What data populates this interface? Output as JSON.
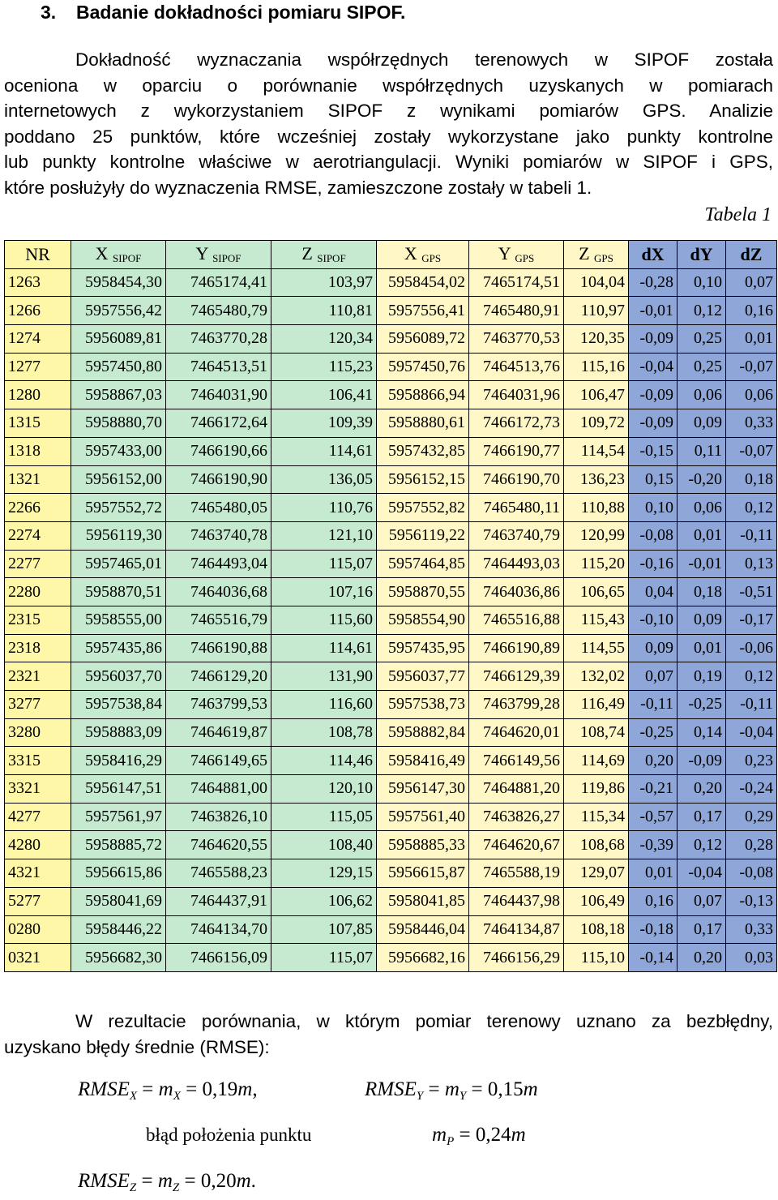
{
  "section": {
    "number": "3.",
    "title": "Badanie dokładności pomiaru SIPOF."
  },
  "intro_lines": [
    "Dokładność wyznaczania współrzędnych terenowych w SIPOF została",
    "oceniona w oparciu o porównanie współrzędnych uzyskanych w pomiarach",
    "internetowych z wykorzystaniem SIPOF z wynikami pomiarów GPS. Analizie",
    "poddano 25 punktów, które wcześniej zostały wykorzystane jako punkty kontrolne",
    "lub punkty kontrolne właściwe w aerotriangulacji. Wyniki pomiarów w SIPOF i GPS,",
    "które posłużyły do wyznaczenia RMSE, zamieszczone zostały w tabeli 1."
  ],
  "caption": "Tabela 1",
  "table": {
    "headers": [
      {
        "main": "NR",
        "sub": ""
      },
      {
        "main": "X",
        "sub": "SIPOF"
      },
      {
        "main": "Y",
        "sub": "SIPOF"
      },
      {
        "main": "Z",
        "sub": "SIPOF"
      },
      {
        "main": "X",
        "sub": "GPS"
      },
      {
        "main": "Y",
        "sub": "GPS"
      },
      {
        "main": "Z",
        "sub": "GPS"
      },
      {
        "main": "dX",
        "sub": ""
      },
      {
        "main": "dY",
        "sub": ""
      },
      {
        "main": "dZ",
        "sub": ""
      }
    ],
    "rows": [
      [
        "1263",
        "5958454,30",
        "7465174,41",
        "103,97",
        "5958454,02",
        "7465174,51",
        "104,04",
        "-0,28",
        "0,10",
        "0,07"
      ],
      [
        "1266",
        "5957556,42",
        "7465480,79",
        "110,81",
        "5957556,41",
        "7465480,91",
        "110,97",
        "-0,01",
        "0,12",
        "0,16"
      ],
      [
        "1274",
        "5956089,81",
        "7463770,28",
        "120,34",
        "5956089,72",
        "7463770,53",
        "120,35",
        "-0,09",
        "0,25",
        "0,01"
      ],
      [
        "1277",
        "5957450,80",
        "7464513,51",
        "115,23",
        "5957450,76",
        "7464513,76",
        "115,16",
        "-0,04",
        "0,25",
        "-0,07"
      ],
      [
        "1280",
        "5958867,03",
        "7464031,90",
        "106,41",
        "5958866,94",
        "7464031,96",
        "106,47",
        "-0,09",
        "0,06",
        "0,06"
      ],
      [
        "1315",
        "5958880,70",
        "7466172,64",
        "109,39",
        "5958880,61",
        "7466172,73",
        "109,72",
        "-0,09",
        "0,09",
        "0,33"
      ],
      [
        "1318",
        "5957433,00",
        "7466190,66",
        "114,61",
        "5957432,85",
        "7466190,77",
        "114,54",
        "-0,15",
        "0,11",
        "-0,07"
      ],
      [
        "1321",
        "5956152,00",
        "7466190,90",
        "136,05",
        "5956152,15",
        "7466190,70",
        "136,23",
        "0,15",
        "-0,20",
        "0,18"
      ],
      [
        "2266",
        "5957552,72",
        "7465480,05",
        "110,76",
        "5957552,82",
        "7465480,11",
        "110,88",
        "0,10",
        "0,06",
        "0,12"
      ],
      [
        "2274",
        "5956119,30",
        "7463740,78",
        "121,10",
        "5956119,22",
        "7463740,79",
        "120,99",
        "-0,08",
        "0,01",
        "-0,11"
      ],
      [
        "2277",
        "5957465,01",
        "7464493,04",
        "115,07",
        "5957464,85",
        "7464493,03",
        "115,20",
        "-0,16",
        "-0,01",
        "0,13"
      ],
      [
        "2280",
        "5958870,51",
        "7464036,68",
        "107,16",
        "5958870,55",
        "7464036,86",
        "106,65",
        "0,04",
        "0,18",
        "-0,51"
      ],
      [
        "2315",
        "5958555,00",
        "7465516,79",
        "115,60",
        "5958554,90",
        "7465516,88",
        "115,43",
        "-0,10",
        "0,09",
        "-0,17"
      ],
      [
        "2318",
        "5957435,86",
        "7466190,88",
        "114,61",
        "5957435,95",
        "7466190,89",
        "114,55",
        "0,09",
        "0,01",
        "-0,06"
      ],
      [
        "2321",
        "5956037,70",
        "7466129,20",
        "131,90",
        "5956037,77",
        "7466129,39",
        "132,02",
        "0,07",
        "0,19",
        "0,12"
      ],
      [
        "3277",
        "5957538,84",
        "7463799,53",
        "116,60",
        "5957538,73",
        "7463799,28",
        "116,49",
        "-0,11",
        "-0,25",
        "-0,11"
      ],
      [
        "3280",
        "5958883,09",
        "7464619,87",
        "108,78",
        "5958882,84",
        "7464620,01",
        "108,74",
        "-0,25",
        "0,14",
        "-0,04"
      ],
      [
        "3315",
        "5958416,29",
        "7466149,65",
        "114,46",
        "5958416,49",
        "7466149,56",
        "114,69",
        "0,20",
        "-0,09",
        "0,23"
      ],
      [
        "3321",
        "5956147,51",
        "7464881,00",
        "120,10",
        "5956147,30",
        "7464881,20",
        "119,86",
        "-0,21",
        "0,20",
        "-0,24"
      ],
      [
        "4277",
        "5957561,97",
        "7463826,10",
        "115,05",
        "5957561,40",
        "7463826,27",
        "115,34",
        "-0,57",
        "0,17",
        "0,29"
      ],
      [
        "4280",
        "5958885,72",
        "7464620,55",
        "108,40",
        "5958885,33",
        "7464620,67",
        "108,68",
        "-0,39",
        "0,12",
        "0,28"
      ],
      [
        "4321",
        "5956615,86",
        "7465588,23",
        "129,15",
        "5956615,87",
        "7465588,19",
        "129,07",
        "0,01",
        "-0,04",
        "-0,08"
      ],
      [
        "5277",
        "5958041,69",
        "7464437,91",
        "106,62",
        "5958041,85",
        "7464437,98",
        "106,49",
        "0,16",
        "0,07",
        "-0,13"
      ],
      [
        "0280",
        "5958446,22",
        "7464134,70",
        "107,85",
        "5958446,04",
        "7464134,87",
        "108,18",
        "-0,18",
        "0,17",
        "0,33"
      ],
      [
        "0321",
        "5956682,30",
        "7466156,09",
        "115,07",
        "5956682,16",
        "7466156,29",
        "115,10",
        "-0,14",
        "0,20",
        "0,03"
      ]
    ]
  },
  "result_lines": [
    "W rezultacie porównania, w którym pomiar terenowy uznano za bezbłędny,",
    "uzyskano błędy średnie (RMSE):"
  ],
  "formulas": {
    "rmse_x": {
      "lhs": "RMSE",
      "sub": "X",
      "m": "m",
      "msub": "X",
      "value": "0,19",
      "unit": "m",
      "tail": ","
    },
    "rmse_y": {
      "lhs": "RMSE",
      "sub": "Y",
      "m": "m",
      "msub": "Y",
      "value": "0,15",
      "unit": "m",
      "tail": ""
    },
    "position_label": "błąd położenia punktu",
    "mp": {
      "m": "m",
      "msub": "P",
      "value": "0,24",
      "unit": "m"
    },
    "rmse_z": {
      "lhs": "RMSE",
      "sub": "Z",
      "m": "m",
      "msub": "Z",
      "value": "0,20",
      "unit": "m",
      "tail": "."
    }
  }
}
